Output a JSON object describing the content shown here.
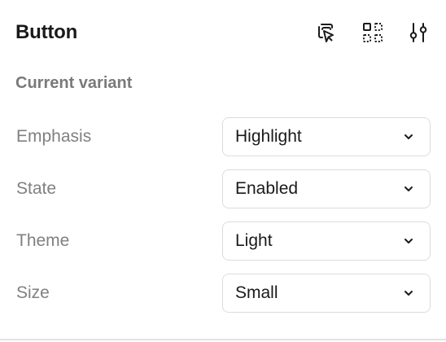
{
  "panel": {
    "title": "Button",
    "actions": [
      {
        "icon": "select-instance-icon"
      },
      {
        "icon": "component-grid-icon"
      },
      {
        "icon": "adjust-sliders-icon"
      }
    ]
  },
  "section": {
    "title": "Current variant"
  },
  "properties": [
    {
      "label": "Emphasis",
      "value": "Highlight"
    },
    {
      "label": "State",
      "value": "Enabled"
    },
    {
      "label": "Theme",
      "value": "Light"
    },
    {
      "label": "Size",
      "value": "Small"
    }
  ]
}
